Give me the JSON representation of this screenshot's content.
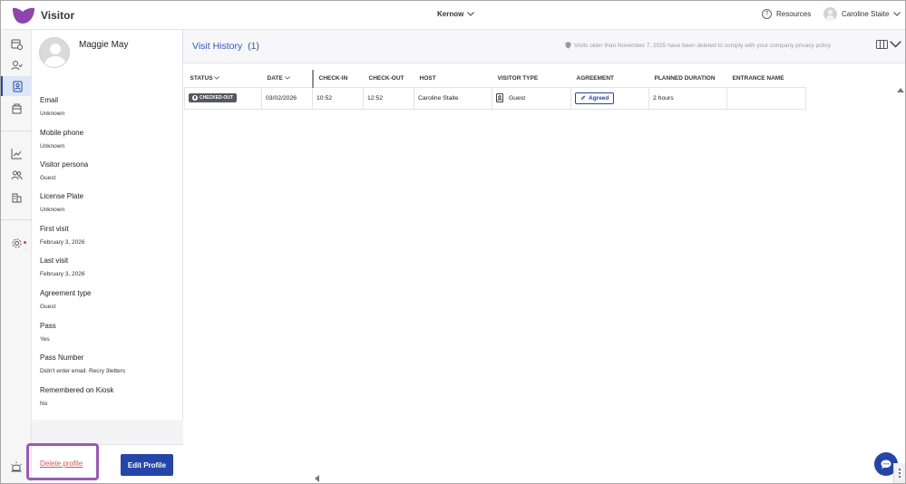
{
  "app": {
    "name": "Visitor",
    "brand_color": "#8e44ad",
    "accent": "#2346a8"
  },
  "topbar": {
    "location": "Kernow",
    "resources_label": "Resources",
    "user_name": "Caroline Staite"
  },
  "rail": {
    "items": [
      "calendar-clock-icon",
      "user-check-icon",
      "visitor-badge-icon",
      "package-icon",
      "analytics-icon",
      "users-icon",
      "building-icon",
      "settings-icon",
      "alert-bell-icon"
    ]
  },
  "profile": {
    "name": "Maggie May",
    "fields": [
      {
        "label": "Email",
        "value": "Unknown"
      },
      {
        "label": "Mobile phone",
        "value": "Unknown"
      },
      {
        "label": "Visitor persona",
        "value": "Guest"
      },
      {
        "label": "License Plate",
        "value": "Unknown"
      },
      {
        "label": "First visit",
        "value": "February 3, 2026"
      },
      {
        "label": "Last visit",
        "value": "February 3, 2026"
      },
      {
        "label": "Agreement type",
        "value": "Guest"
      },
      {
        "label": "Pass",
        "value": "Yes"
      },
      {
        "label": "Pass Number",
        "value": "Didn't enter email. Recry 3letters"
      },
      {
        "label": "Remembered on Kiosk",
        "value": "No"
      }
    ],
    "delete_label": "Delete profile",
    "edit_label": "Edit Profile"
  },
  "visit_history": {
    "title": "Visit History",
    "count": "(1)",
    "privacy_note": "Visits older than November 7, 2025 have been deleted to comply with your company privacy policy",
    "columns": [
      "STATUS",
      "DATE",
      "CHECK-IN",
      "CHECK-OUT",
      "HOST",
      "VISITOR TYPE",
      "AGREEMENT",
      "PLANNED DURATION",
      "ENTRANCE NAME"
    ],
    "rows": [
      {
        "status": "CHECKED-OUT",
        "date": "03/02/2026",
        "check_in": "10:52",
        "check_out": "12:52",
        "host": "Caroline Staite",
        "visitor_type": "Guest",
        "agreement": "Agreed",
        "planned_duration": "2 hours",
        "entrance_name": ""
      }
    ]
  }
}
